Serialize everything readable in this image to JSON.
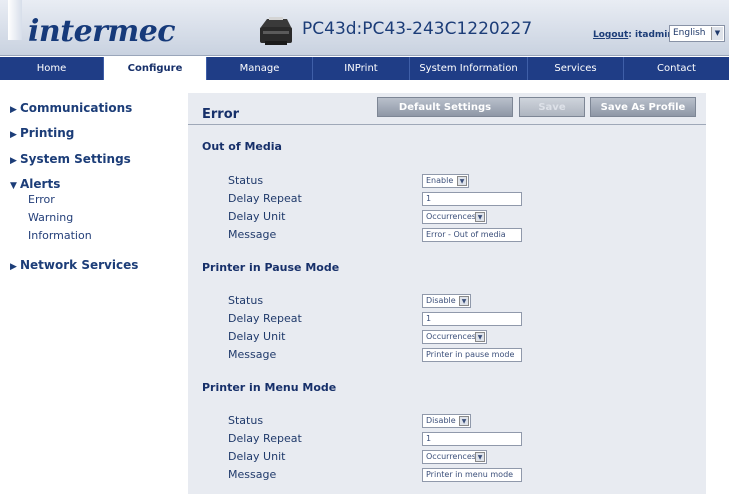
{
  "header": {
    "logo_text": "intermec",
    "device_title": "PC43d:PC43-243C1220227",
    "logout_label": "Logout",
    "user_label": ": itadmin",
    "language": {
      "selected": "English"
    }
  },
  "nav": {
    "items": [
      {
        "label": "Home",
        "active": false
      },
      {
        "label": "Configure",
        "active": true
      },
      {
        "label": "Manage",
        "active": false
      },
      {
        "label": "INPrint",
        "active": false
      },
      {
        "label": "System Information",
        "active": false
      },
      {
        "label": "Services",
        "active": false
      },
      {
        "label": "Contact",
        "active": false
      }
    ]
  },
  "sidebar": {
    "items": [
      {
        "label": "Communications",
        "expanded": false
      },
      {
        "label": "Printing",
        "expanded": false
      },
      {
        "label": "System Settings",
        "expanded": false
      },
      {
        "label": "Alerts",
        "expanded": true,
        "children": [
          "Error",
          "Warning",
          "Information"
        ]
      },
      {
        "label": "Network Services",
        "expanded": false
      }
    ]
  },
  "main": {
    "title": "Error",
    "buttons": {
      "default_settings": "Default Settings",
      "save": "Save",
      "save_as_profile": "Save As Profile"
    },
    "field_labels": {
      "status": "Status",
      "delay_repeat": "Delay Repeat",
      "delay_unit": "Delay Unit",
      "message": "Message"
    },
    "sections": [
      {
        "title": "Out of Media",
        "status": "Enable",
        "delay_repeat": "1",
        "delay_unit": "Occurrences",
        "message": "Error - Out of media"
      },
      {
        "title": "Printer in Pause Mode",
        "status": "Disable",
        "delay_repeat": "1",
        "delay_unit": "Occurrences",
        "message": "Printer in pause mode"
      },
      {
        "title": "Printer in Menu Mode",
        "status": "Disable",
        "delay_repeat": "1",
        "delay_unit": "Occurrences",
        "message": "Printer in menu mode"
      }
    ]
  },
  "colors": {
    "nav_bg": "#1f3d86",
    "brand_text": "#163a7a",
    "panel_bg": "#e8ebf1"
  },
  "icons": [
    "printer-icon",
    "chevron-down-icon",
    "triangle-right-icon",
    "triangle-down-icon"
  ]
}
